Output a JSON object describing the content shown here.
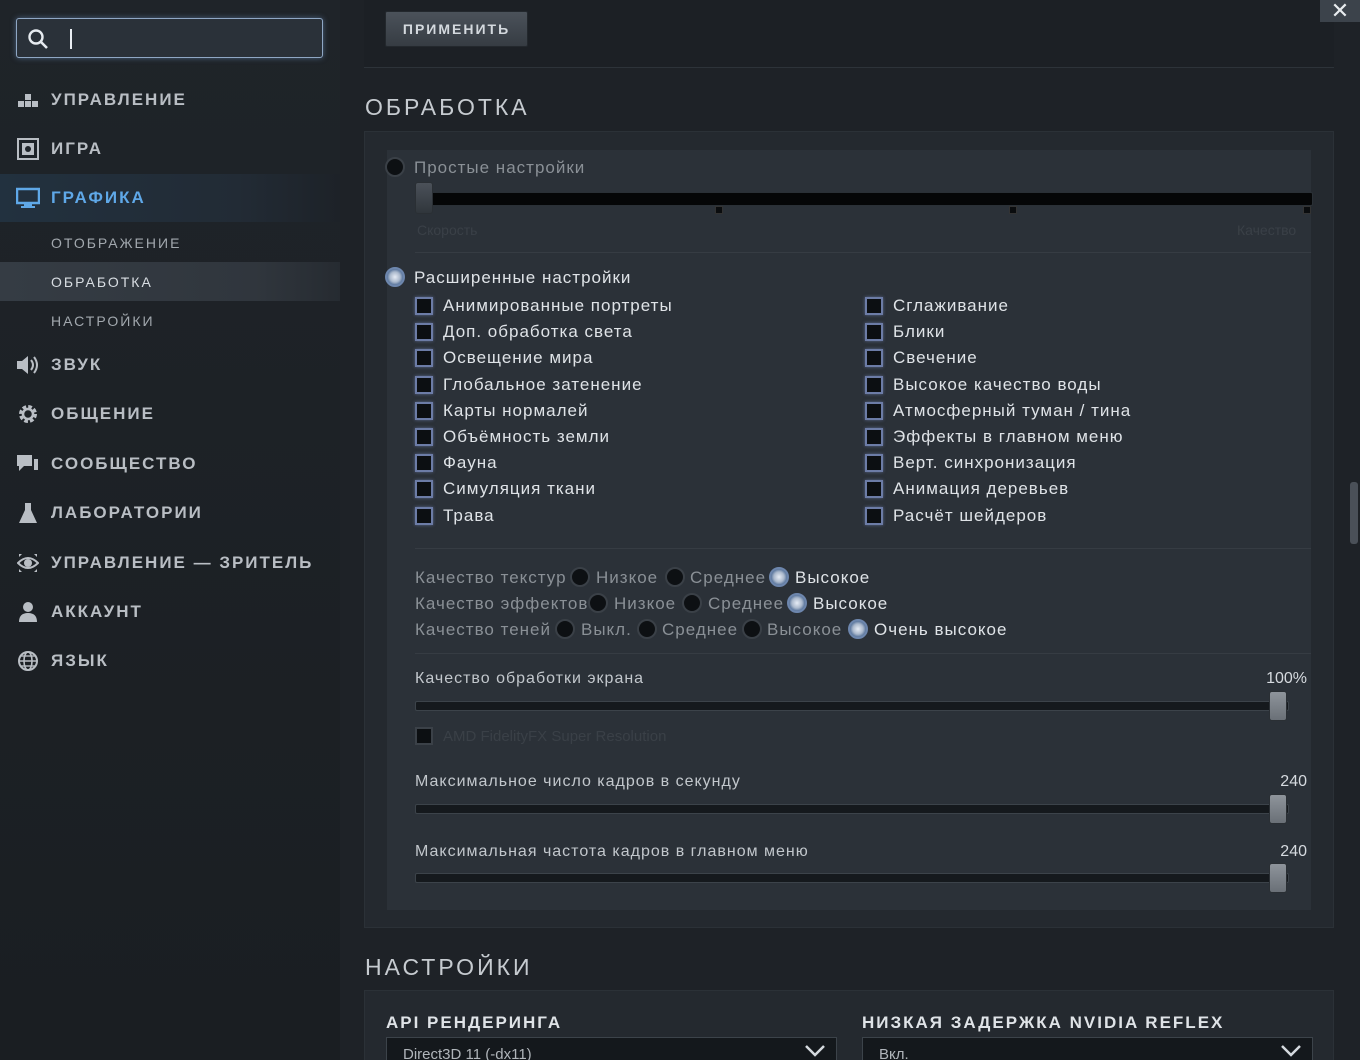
{
  "search": {
    "placeholder": ""
  },
  "sidebar": {
    "items": [
      {
        "label": "УПРАВЛЕНИЕ",
        "icon": "controls-icon"
      },
      {
        "label": "ИГРА",
        "icon": "game-icon"
      },
      {
        "label": "ГРАФИКА",
        "icon": "monitor-icon"
      },
      {
        "label": "ЗВУК",
        "icon": "speaker-icon"
      },
      {
        "label": "ОБЩЕНИЕ",
        "icon": "gear-icon"
      },
      {
        "label": "СООБЩЕСТВО",
        "icon": "chat-icon"
      },
      {
        "label": "ЛАБОРАТОРИИ",
        "icon": "flask-icon"
      },
      {
        "label": "УПРАВЛЕНИЕ — ЗРИТЕЛЬ",
        "icon": "eye-icon"
      },
      {
        "label": "АККАУНТ",
        "icon": "user-icon"
      },
      {
        "label": "ЯЗЫК",
        "icon": "globe-icon"
      }
    ],
    "sub_items": [
      "ОТОБРАЖЕНИЕ",
      "ОБРАБОТКА",
      "НАСТРОЙКИ"
    ],
    "active_item": "ГРАФИКА",
    "active_sub": "ОБРАБОТКА"
  },
  "top": {
    "apply_label": "ПРИМЕНИТЬ"
  },
  "close_label": "✕",
  "processing": {
    "title": "ОБРАБОТКА",
    "simple_label": "Простые настройки",
    "simple_left": "Скорость",
    "simple_right": "Качество",
    "advanced_label": "Расширенные настройки",
    "checks_left": [
      "Анимированные портреты",
      "Доп. обработка света",
      "Освещение мира",
      "Глобальное затенение",
      "Карты нормалей",
      "Объёмность земли",
      "Фауна",
      "Симуляция ткани",
      "Трава"
    ],
    "checks_right": [
      "Сглаживание",
      "Блики",
      "Свечение",
      "Высокое качество воды",
      "Атмосферный туман / тина",
      "Эффекты в главном меню",
      "Верт. синхронизация",
      "Анимация деревьев",
      "Расчёт шейдеров"
    ],
    "texture_quality": {
      "label": "Качество текстур",
      "options": [
        "Низкое",
        "Среднее",
        "Высокое"
      ],
      "selected": "Высокое"
    },
    "effects_quality": {
      "label": "Качество эффектов",
      "options": [
        "Низкое",
        "Среднее",
        "Высокое"
      ],
      "selected": "Высокое"
    },
    "shadow_quality": {
      "label": "Качество теней",
      "options": [
        "Выкл.",
        "Среднее",
        "Высокое",
        "Очень высокое"
      ],
      "selected": "Очень высокое"
    },
    "screen_quality": {
      "label": "Качество обработки экрана",
      "value": "100%",
      "level": 1.0
    },
    "fsr_label": "AMD FidelityFX Super Resolution",
    "max_fps": {
      "label": "Максимальное число кадров в секунду",
      "value": "240",
      "level": 1.0
    },
    "max_menu_fps": {
      "label": "Максимальная частота кадров в главном меню",
      "value": "240",
      "level": 1.0
    }
  },
  "settings": {
    "title": "НАСТРОЙКИ",
    "api_title": "API РЕНДЕРИНГА",
    "api_value": "Direct3D 11 (-dx11)",
    "reflex_title": "НИЗКАЯ ЗАДЕРЖКА NVIDIA REFLEX",
    "reflex_value": "Вкл."
  },
  "colors": {
    "accent": "#5fa8e8",
    "bg": "#1e2227"
  }
}
